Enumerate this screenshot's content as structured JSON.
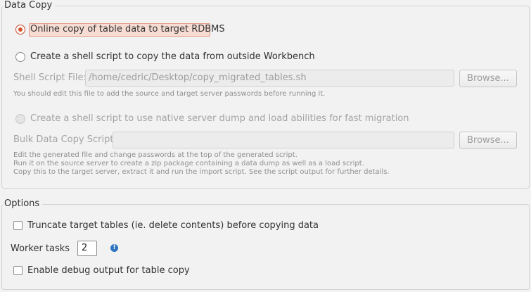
{
  "data_copy": {
    "title": "Data Copy",
    "online_copy_label": "Online copy of table data to target RDBMS",
    "shell_script_label": "Create a shell script to copy the data from outside Workbench",
    "shell_script_file_label": "Shell Script File:",
    "shell_script_file_value": "/home/cedric/Desktop/copy_migrated_tables.sh",
    "browse_label": "Browse...",
    "shell_script_note": "You should edit this file to add the source and target server passwords before running it.",
    "native_dump_label": "Create a shell script to use native server dump and load abilities for fast migration",
    "bulk_script_label": "Bulk Data Copy Script:",
    "bulk_script_value": "",
    "bulk_browse_label": "Browse...",
    "bulk_note_1": "Edit the generated file and change passwords at the top of the generated script.",
    "bulk_note_2": "Run it on the source server to create a zip package containing a data dump as well as a load script.",
    "bulk_note_3": "Copy this to the target server, extract it and run the import script. See the script output for further details."
  },
  "options": {
    "title": "Options",
    "truncate_label": "Truncate target tables (ie. delete contents) before copying data",
    "worker_tasks_label": "Worker tasks",
    "worker_tasks_value": "2",
    "info_icon_glyph": "!",
    "debug_label": "Enable debug output for table copy"
  },
  "colors": {
    "accent": "#d9532c",
    "focus_fill": "#f6dcd3",
    "info_icon": "#2f74c0"
  }
}
